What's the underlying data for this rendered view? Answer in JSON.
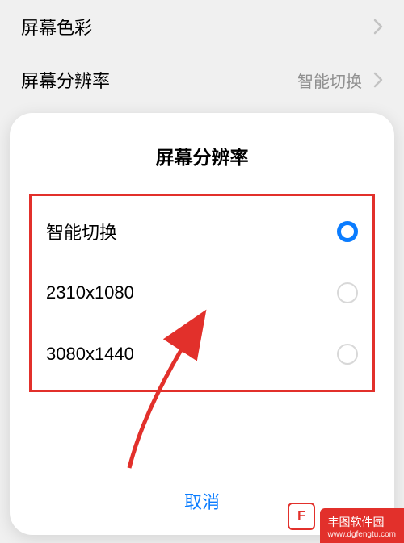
{
  "settings": {
    "color_row": {
      "label": "屏幕色彩"
    },
    "resolution_row": {
      "label": "屏幕分辨率",
      "value": "智能切换"
    }
  },
  "dialog": {
    "title": "屏幕分辨率",
    "options": [
      {
        "label": "智能切换",
        "selected": true
      },
      {
        "label": "2310x1080",
        "selected": false
      },
      {
        "label": "3080x1440",
        "selected": false
      }
    ],
    "cancel": "取消"
  },
  "watermark": {
    "brand": "丰图软件园",
    "url": "www.dgfengtu.com",
    "logo_letter": "F"
  }
}
